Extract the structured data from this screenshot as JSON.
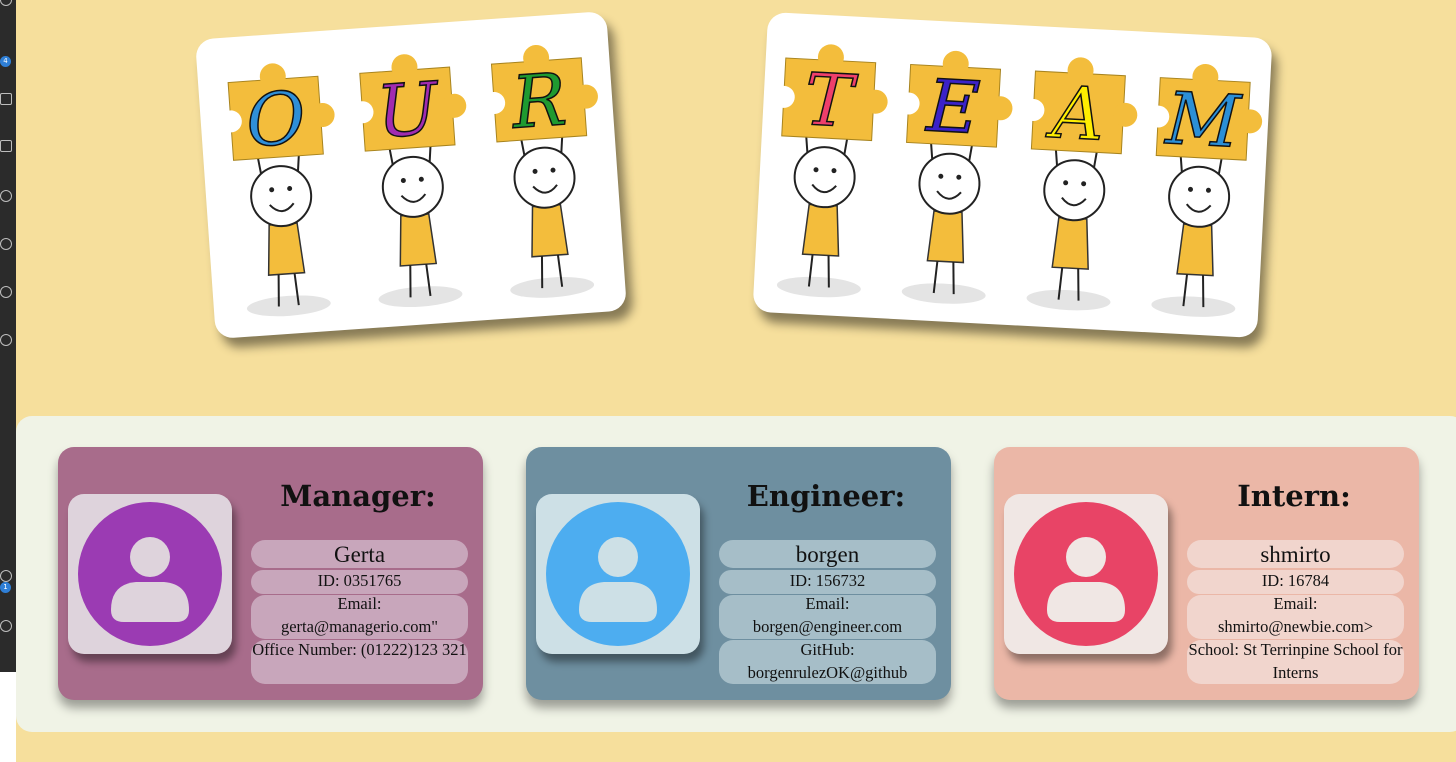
{
  "banner": {
    "our_letters": [
      {
        "letter": "O",
        "color": "#2f8fd8"
      },
      {
        "letter": "U",
        "color": "#a12bb0"
      },
      {
        "letter": "R",
        "color": "#1f9a30"
      }
    ],
    "team_letters": [
      {
        "letter": "T",
        "color": "#ef3f6b"
      },
      {
        "letter": "E",
        "color": "#3b22c8"
      },
      {
        "letter": "A",
        "color": "#ffee00"
      },
      {
        "letter": "M",
        "color": "#2b8fd6"
      }
    ],
    "puzzle_color": "#f3bd3c"
  },
  "activity_bar": {
    "badges": [
      "4",
      "1"
    ]
  },
  "team": [
    {
      "role": "Manager:",
      "name": "Gerta",
      "id_text": "ID: 0351765",
      "email_label": "Email:",
      "email": "gerta@managerio.com\"",
      "extra_text": "Office Number: (01222)123 321",
      "card_color": "#a86c8b",
      "avatar_color": "#9b3bb3",
      "avatar_icon": "user-avatar-icon"
    },
    {
      "role": "Engineer:",
      "name": "borgen",
      "id_text": "ID: 156732",
      "email_label": "Email:",
      "email": "borgen@engineer.com",
      "extra_text": "GitHub: borgenrulezOK@github",
      "card_color": "#6e8fa0",
      "avatar_color": "#4dadf0",
      "avatar_icon": "user-avatar-icon"
    },
    {
      "role": "Intern:",
      "name": "shmirto",
      "id_text": "ID: 16784",
      "email_label": "Email:",
      "email": "shmirto@newbie.com>",
      "extra_text": "School: St Terrinpine School for Interns",
      "card_color": "#ebb7a7",
      "avatar_color": "#e84466",
      "avatar_icon": "user-avatar-icon"
    }
  ]
}
